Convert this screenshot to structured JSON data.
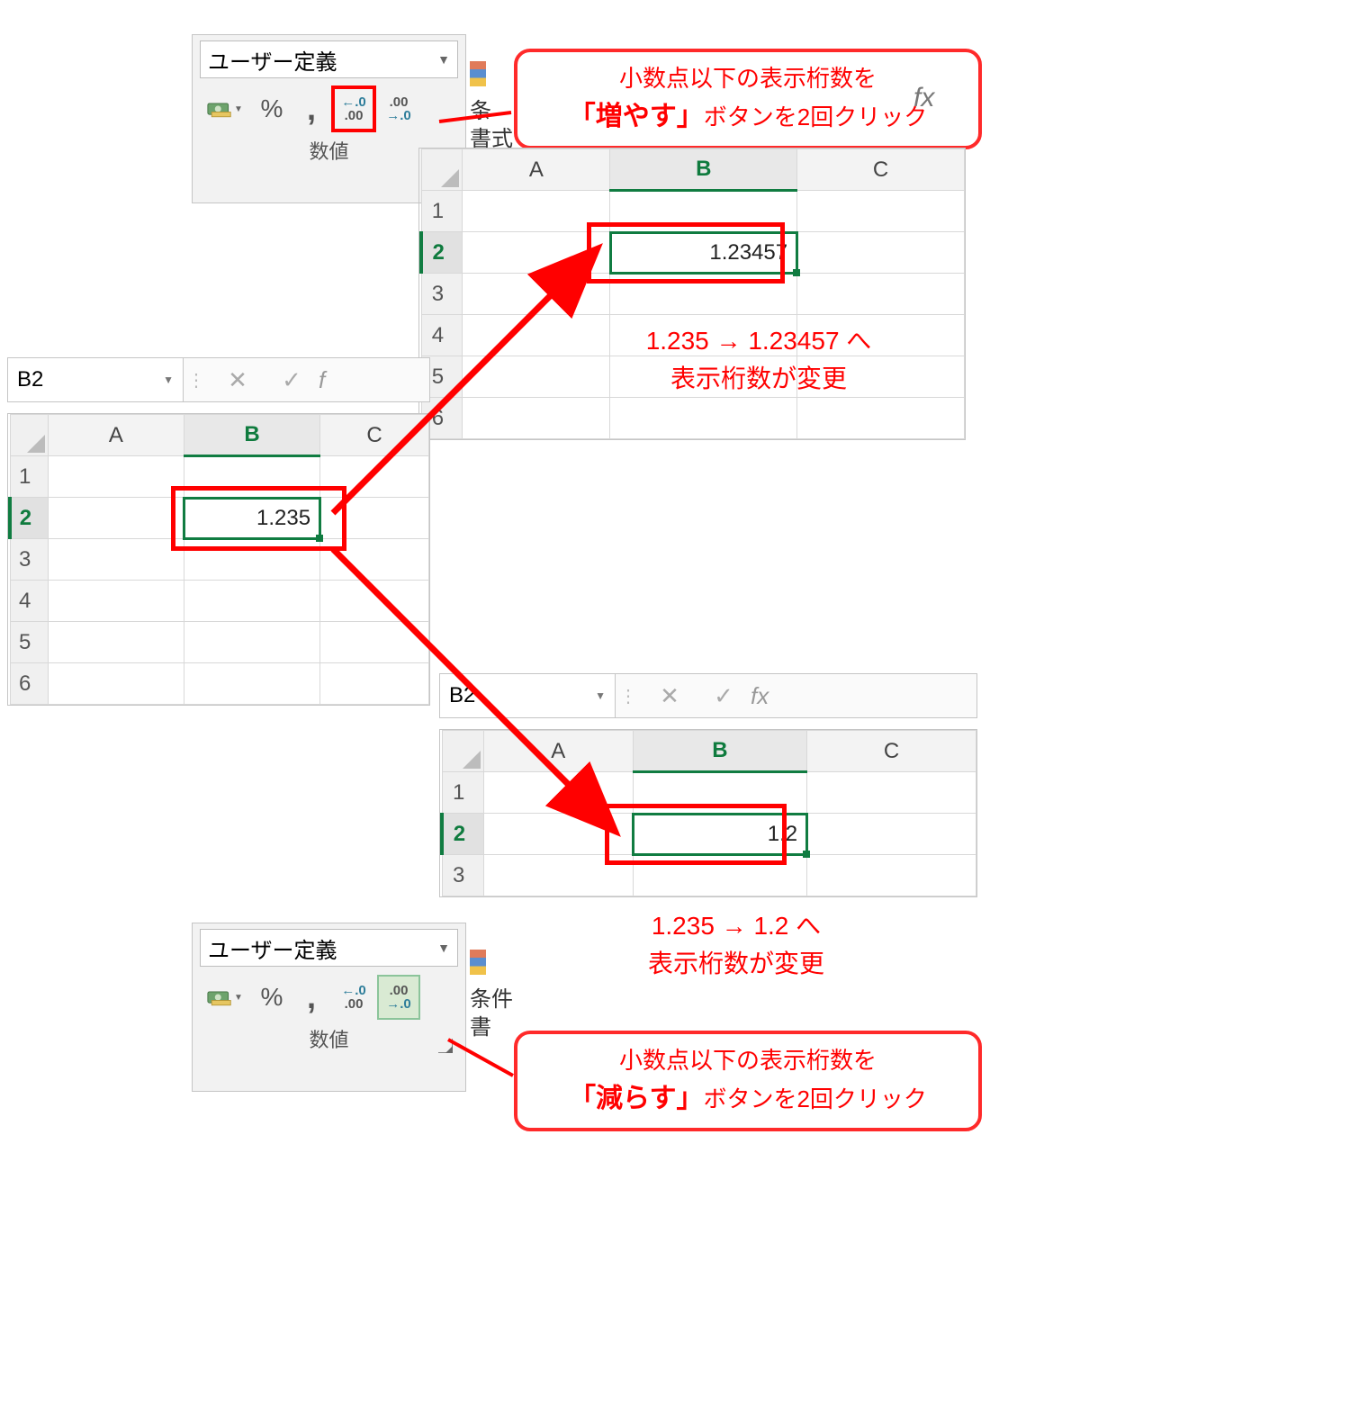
{
  "ribbon": {
    "format_name": "ユーザー定義",
    "percent": "%",
    "comma": ",",
    "inc_top": "←.0",
    "inc_bot": ".00",
    "dec_top": ".00",
    "dec_bot": "→.0",
    "group_label": "数値",
    "side1": "条",
    "side2": "書式",
    "side2b": "条件",
    "side2c": "書"
  },
  "callout_inc": {
    "line1": "小数点以下の表示桁数を",
    "em": "「増やす」",
    "line2_rest": "ボタンを2回クリック"
  },
  "callout_dec": {
    "line1": "小数点以下の表示桁数を",
    "em": "「減らす」",
    "line2_rest": "ボタンを2回クリック"
  },
  "sheets": {
    "namebox": "B2",
    "fx": "fx",
    "colA": "A",
    "colB": "B",
    "colC": "C",
    "rows": [
      "1",
      "2",
      "3",
      "4",
      "5",
      "6"
    ],
    "left_val": "1.235",
    "inc_val": "1.23457",
    "dec_val": "1.2"
  },
  "anno_inc": {
    "l1": "1.235 → 1.23457 へ",
    "l2": "表示桁数が変更"
  },
  "anno_dec": {
    "l1": "1.235 → 1.2 へ",
    "l2": "表示桁数が変更"
  }
}
